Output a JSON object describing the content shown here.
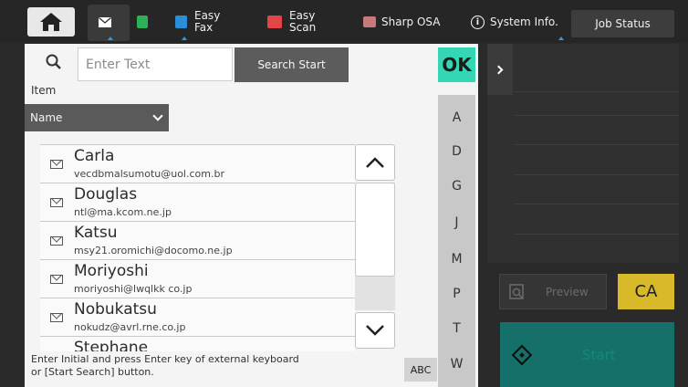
{
  "topbar": {
    "easy_fax": "Easy\nFax",
    "easy_scan": "Easy\nScan",
    "sharp_osa": "Sharp OSA",
    "system_info": "System Info.",
    "job_status": "Job Status",
    "system_info_glyph": "i"
  },
  "search": {
    "placeholder": "Enter Text",
    "button": "Search Start",
    "ok": "OK",
    "item_label": "Item",
    "sort_value": "Name"
  },
  "contacts": [
    {
      "name": "Carla",
      "email": "vecdbmalsumotu@uol.com.br"
    },
    {
      "name": "Douglas",
      "email": "ntl@ma.kcom.ne.jp"
    },
    {
      "name": "Katsu",
      "email": "msy21.oromichi@docomo.ne.jp"
    },
    {
      "name": "Moriyoshi",
      "email": "moriyoshi@lwqlkk co.jp"
    },
    {
      "name": "Nobukatsu",
      "email": "nokudz@avrl.rne.co.jp"
    },
    {
      "name": "Stephane",
      "email": ""
    }
  ],
  "alphabet": [
    "A",
    "D",
    "G",
    "J",
    "M",
    "P",
    "T",
    "W"
  ],
  "hint": "Enter Initial and press Enter key of external keyboard or [Start Search] button.",
  "abc": "ABC",
  "right": {
    "preview": "Preview",
    "ca": "CA",
    "start": "Start"
  },
  "colors": {
    "ok": "#34d6b4",
    "ca": "#d7b92a",
    "start": "#16706a",
    "accent_dot": "#2a9fd8"
  }
}
